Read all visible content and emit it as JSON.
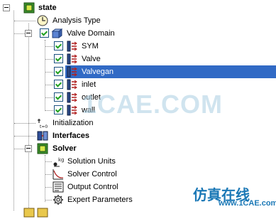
{
  "tree": {
    "root": {
      "label": "state",
      "icon": "cube-icon"
    },
    "items": [
      {
        "label": "Analysis Type",
        "icon": "clock-icon"
      },
      {
        "label": "Valve Domain",
        "icon": "domain-icon",
        "checked": true
      },
      {
        "label": "SYM",
        "icon": "boundary-icon",
        "checked": true
      },
      {
        "label": "Valve",
        "icon": "boundary-icon",
        "checked": true
      },
      {
        "label": "Valvegan",
        "icon": "boundary-icon",
        "checked": true,
        "selected": true
      },
      {
        "label": "inlet",
        "icon": "boundary-icon",
        "checked": true
      },
      {
        "label": "outlet",
        "icon": "boundary-icon",
        "checked": true
      },
      {
        "label": "wall",
        "icon": "boundary-icon",
        "checked": true
      },
      {
        "label": "Initialization",
        "icon": "initialization-icon"
      },
      {
        "label": "Interfaces",
        "icon": "interfaces-icon"
      },
      {
        "label": "Solver",
        "icon": "cube-icon"
      },
      {
        "label": "Solution Units",
        "icon": "solution-units-icon"
      },
      {
        "label": "Solver Control",
        "icon": "solver-control-icon"
      },
      {
        "label": "Output Control",
        "icon": "output-control-icon"
      },
      {
        "label": "Expert Parameters",
        "icon": "gear-icon"
      }
    ]
  },
  "watermark": {
    "main": "1CAE.COM",
    "chinese": "仿真在线",
    "url": "www.1CAE.com"
  },
  "colors": {
    "selection": "#316ac5",
    "watermark_blue": "#1b78b6"
  }
}
